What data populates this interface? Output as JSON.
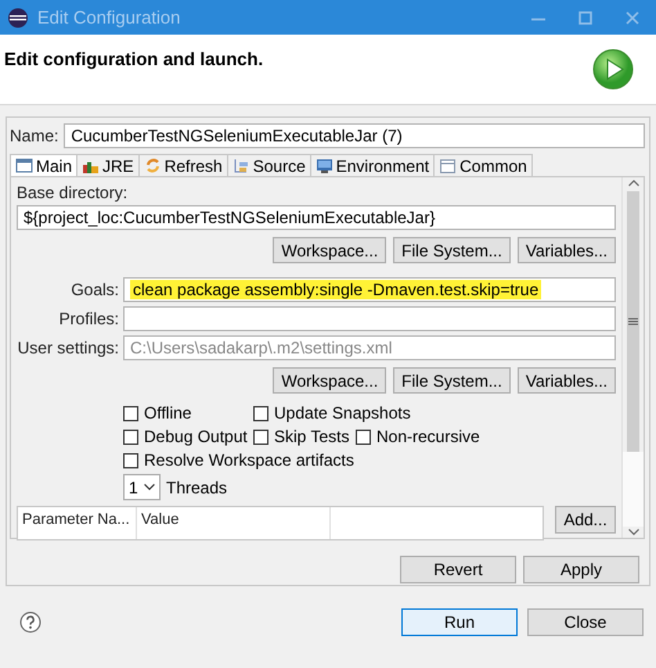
{
  "window": {
    "title": "Edit Configuration"
  },
  "header": {
    "title": "Edit configuration and launch."
  },
  "name": {
    "label": "Name:",
    "value": "CucumberTestNGSeleniumExecutableJar (7)"
  },
  "tabs": [
    {
      "label": "Main",
      "selected": true
    },
    {
      "label": "JRE",
      "selected": false
    },
    {
      "label": "Refresh",
      "selected": false
    },
    {
      "label": "Source",
      "selected": false
    },
    {
      "label": "Environment",
      "selected": false
    },
    {
      "label": "Common",
      "selected": false
    }
  ],
  "base_directory": {
    "label": "Base directory:",
    "value": "${project_loc:CucumberTestNGSeleniumExecutableJar}",
    "buttons": [
      "Workspace...",
      "File System...",
      "Variables..."
    ]
  },
  "fields": [
    {
      "label": "Goals:",
      "value": "clean package assembly:single -Dmaven.test.skip=true",
      "highlighted": true
    },
    {
      "label": "Profiles:",
      "highlighted": false
    },
    {
      "label": "User settings:",
      "placeholder": "C:\\Users\\sadakarp\\.m2\\settings.xml",
      "highlighted": false
    }
  ],
  "settings_buttons": [
    "Workspace...",
    "File System...",
    "Variables..."
  ],
  "option_rows": [
    [
      {
        "label": "Offline",
        "checked": false
      },
      {
        "label": "Update Snapshots",
        "checked": false
      }
    ],
    [
      {
        "label": "Debug Output",
        "checked": false
      },
      {
        "label": "Skip Tests",
        "checked": false
      },
      {
        "label": "Non-recursive",
        "checked": false
      }
    ],
    [
      {
        "label": "Resolve Workspace artifacts",
        "checked": false
      }
    ]
  ],
  "threads": {
    "value": "1",
    "label": "Threads"
  },
  "parameters": {
    "columns": [
      "Parameter Na...",
      "Value"
    ],
    "button": "Add..."
  },
  "panel_buttons": [
    "Revert",
    "Apply"
  ],
  "dialog_buttons": [
    {
      "label": "Run",
      "default": true
    },
    {
      "label": "Close",
      "default": false
    }
  ]
}
